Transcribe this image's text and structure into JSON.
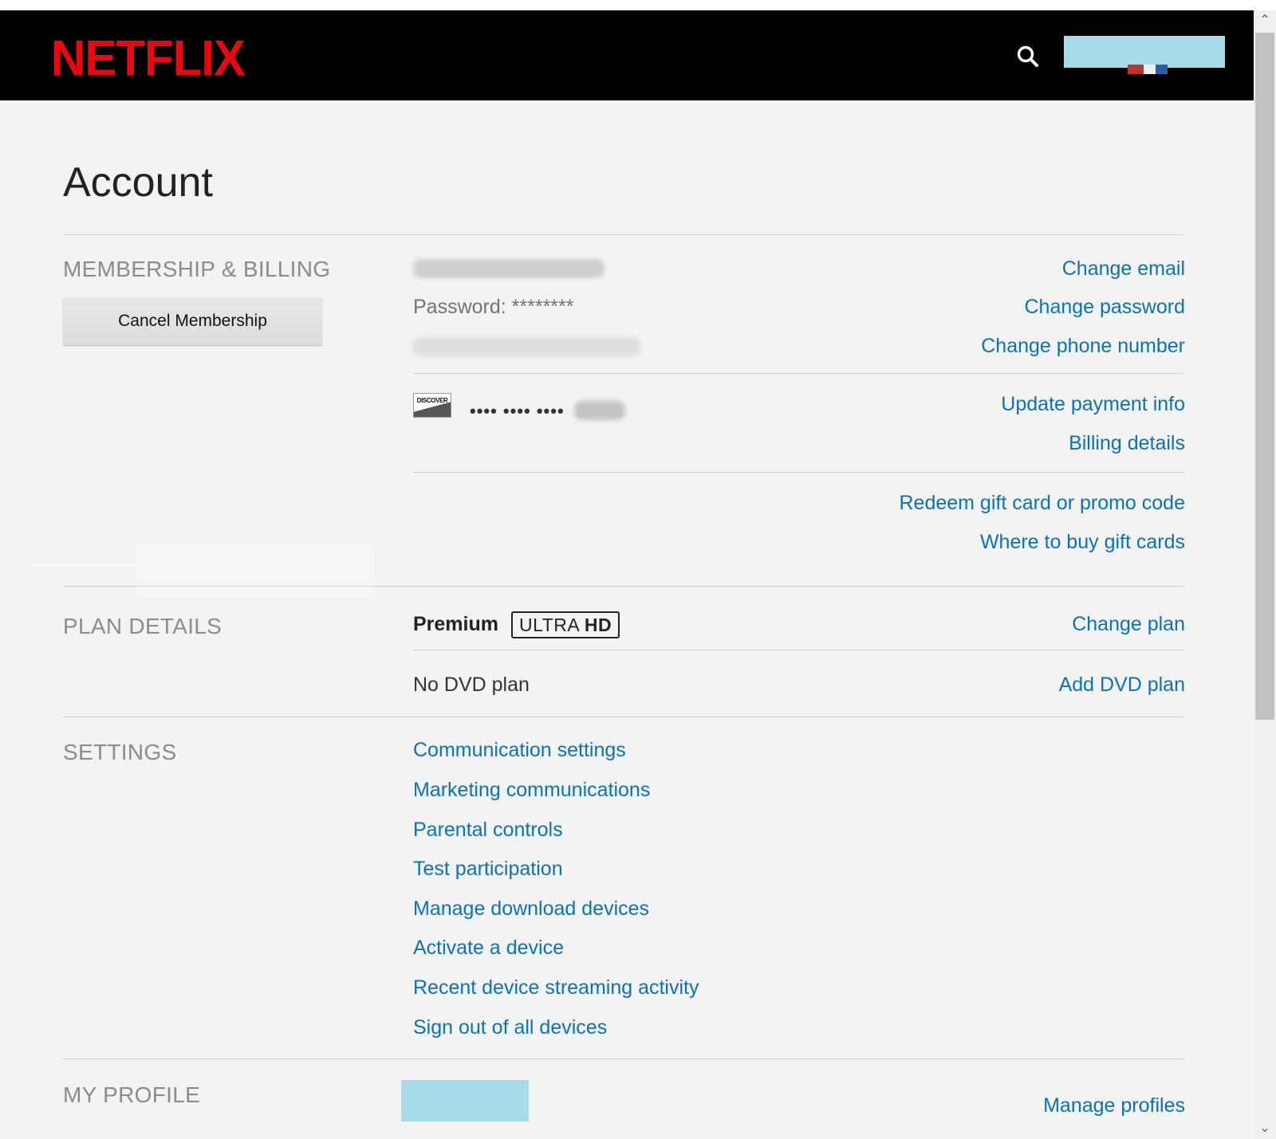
{
  "header": {
    "logo_text": "NETFLIX",
    "search_icon": "search-icon",
    "brand_color": "#e50914"
  },
  "page": {
    "title": "Account",
    "link_color": "#0b72b9"
  },
  "membership": {
    "label": "MEMBERSHIP & BILLING",
    "cancel_button": "Cancel Membership",
    "password_line": "Password: ********",
    "links": {
      "change_email": "Change email",
      "change_password": "Change password",
      "change_phone": "Change phone number",
      "update_payment": "Update payment info",
      "billing_details": "Billing details",
      "redeem": "Redeem gift card or promo code",
      "where_to_buy": "Where to buy gift cards"
    },
    "card": {
      "brand": "DISCOVER",
      "masked": "•••• •••• ••••"
    }
  },
  "plan": {
    "label": "PLAN DETAILS",
    "plan_name": "Premium",
    "badge_light": "ULTRA",
    "badge_bold": "HD",
    "change_plan": "Change plan",
    "dvd_status": "No DVD plan",
    "add_dvd": "Add DVD plan"
  },
  "settings": {
    "label": "SETTINGS",
    "items": [
      "Communication settings",
      "Marketing communications",
      "Parental controls",
      "Test participation",
      "Manage download devices",
      "Activate a device",
      "Recent device streaming activity",
      "Sign out of all devices"
    ]
  },
  "profile": {
    "label": "MY PROFILE",
    "manage": "Manage profiles"
  },
  "scrollbar": {
    "up_icon": "chevron-up-icon",
    "down_icon": "chevron-down-icon"
  }
}
